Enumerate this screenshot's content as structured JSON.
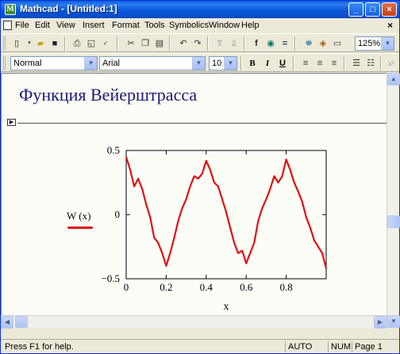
{
  "window": {
    "title": "Mathcad - [Untitled:1]",
    "minimize": "_",
    "maximize": "□",
    "close": "×"
  },
  "menu": {
    "items": [
      "File",
      "Edit",
      "View",
      "Insert",
      "Format",
      "Tools",
      "Symbolics",
      "Window",
      "Help"
    ],
    "close_doc": "×"
  },
  "toolbar": {
    "zoom": "125%",
    "style": "Normal",
    "font": "Arial",
    "size": "10",
    "bold": "B",
    "italic": "I",
    "underline": "U"
  },
  "document": {
    "heading": "Функция Вейерштрасса"
  },
  "chart_data": {
    "type": "line",
    "function": "W(x)",
    "xlabel": "x",
    "ylabel": "",
    "xlim": [
      0,
      1
    ],
    "ylim": [
      -0.5,
      0.5
    ],
    "x_ticks": [
      "0",
      "0.2",
      "0.4",
      "0.6",
      "0.8"
    ],
    "y_ticks": [
      "0.5",
      "0",
      "−0.5"
    ],
    "legend": "W (x)",
    "series": [
      {
        "name": "W (x)",
        "color": "#e01010",
        "x": [
          0,
          0.02,
          0.04,
          0.06,
          0.08,
          0.1,
          0.12,
          0.14,
          0.16,
          0.18,
          0.2,
          0.22,
          0.24,
          0.26,
          0.28,
          0.3,
          0.32,
          0.34,
          0.36,
          0.38,
          0.4,
          0.42,
          0.44,
          0.46,
          0.48,
          0.5,
          0.52,
          0.54,
          0.56,
          0.58,
          0.6,
          0.62,
          0.64,
          0.66,
          0.68,
          0.7,
          0.72,
          0.74,
          0.76,
          0.78,
          0.8,
          0.82,
          0.84,
          0.86,
          0.88,
          0.9,
          0.92,
          0.94,
          0.96,
          0.98,
          1.0
        ],
        "values": [
          0.45,
          0.35,
          0.22,
          0.28,
          0.2,
          0.08,
          -0.02,
          -0.18,
          -0.22,
          -0.3,
          -0.4,
          -0.3,
          -0.18,
          -0.05,
          0.05,
          0.12,
          0.22,
          0.3,
          0.28,
          0.32,
          0.42,
          0.35,
          0.25,
          0.22,
          0.12,
          0.02,
          -0.1,
          -0.22,
          -0.3,
          -0.28,
          -0.38,
          -0.3,
          -0.22,
          -0.05,
          0.05,
          0.12,
          0.2,
          0.3,
          0.25,
          0.3,
          0.43,
          0.35,
          0.25,
          0.18,
          0.1,
          -0.02,
          -0.1,
          -0.2,
          -0.25,
          -0.3,
          -0.42
        ]
      }
    ]
  },
  "status": {
    "hint": "Press F1 for help.",
    "mode": "AUTO",
    "num": "NUM",
    "page": "Page 1"
  }
}
